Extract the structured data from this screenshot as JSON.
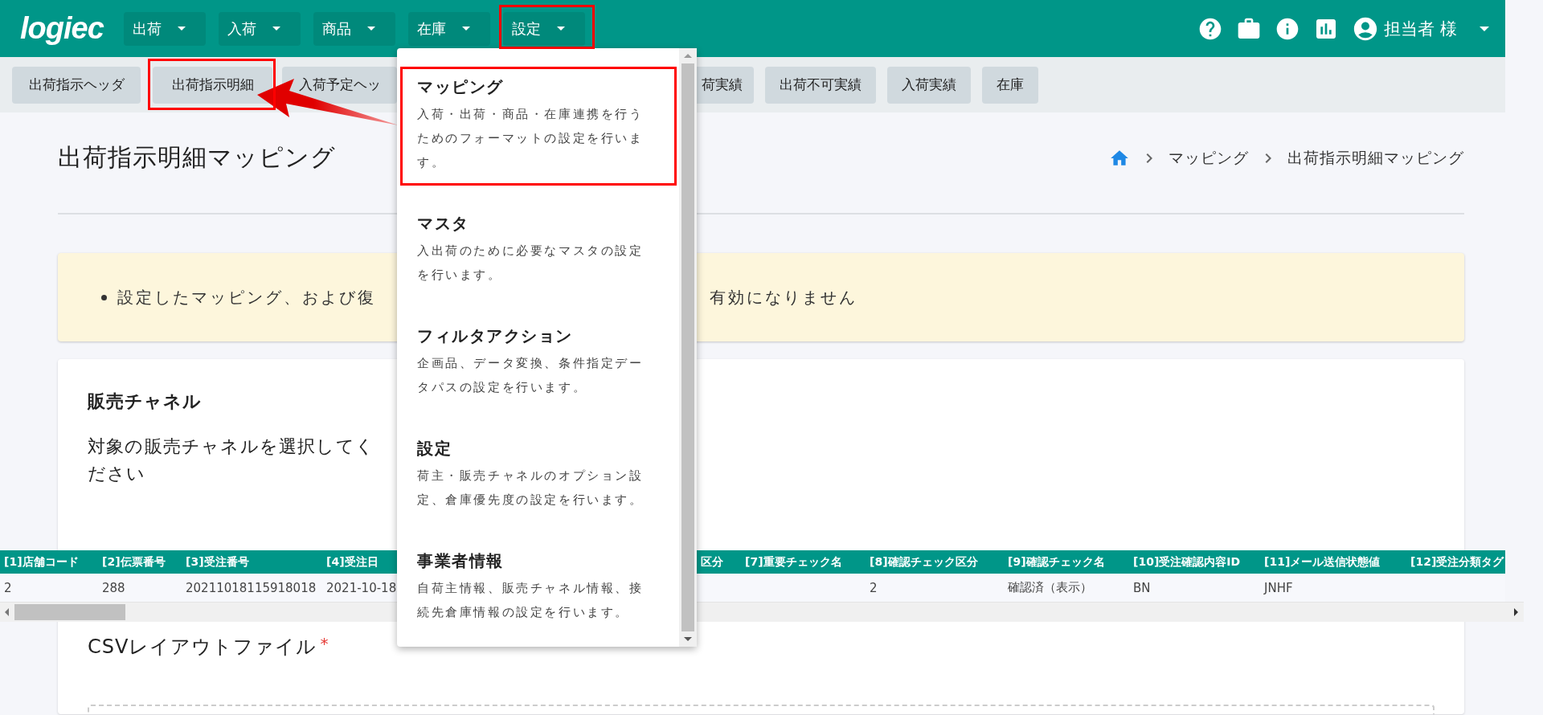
{
  "header": {
    "logo": "logiec",
    "menus": [
      {
        "label": "出荷"
      },
      {
        "label": "入荷"
      },
      {
        "label": "商品"
      },
      {
        "label": "在庫"
      },
      {
        "label": "設定"
      }
    ],
    "user": "担当者 様"
  },
  "subnav": {
    "tabs_left": [
      "出荷指示ヘッダ",
      "出荷指示明細",
      "入荷予定ヘッ"
    ],
    "tabs_right": [
      "荷実績",
      "出荷不可実績",
      "入荷実績",
      "在庫"
    ]
  },
  "page": {
    "title": "出荷指示明細マッピング",
    "breadcrumb": [
      "マッピング",
      "出荷指示明細マッピング"
    ]
  },
  "notice": {
    "text_left": "設定したマッピング、および復",
    "text_right": "有効になりません"
  },
  "card": {
    "section_title": "販売チャネル",
    "description": "対象の販売チャネルを選択してください",
    "file_label": "CSVレイアウトファイル",
    "required_mark": "*"
  },
  "table": {
    "columns": [
      "[1]店舗コード",
      "[2]伝票番号",
      "[3]受注番号",
      "[4]受注日",
      "区分",
      "[7]重要チェック名",
      "[8]確認チェック区分",
      "[9]確認チェック名",
      "[10]受注確認内容ID",
      "[11]メール送信状態値",
      "[12]受注分類タグ"
    ],
    "rows": [
      [
        "2",
        "288",
        "20211018115918018",
        "2021-10-18",
        null,
        null,
        "2",
        "確認済（表示）",
        "BN",
        "JNHF",
        null
      ]
    ]
  },
  "dropdown": {
    "items": [
      {
        "title": "マッピング",
        "description": "入荷・出荷・商品・在庫連携を行うためのフォーマットの設定を行います。"
      },
      {
        "title": "マスタ",
        "description": "入出荷のために必要なマスタの設定を行います。"
      },
      {
        "title": "フィルタアクション",
        "description": "企画品、データ変換、条件指定データパスの設定を行います。"
      },
      {
        "title": "設定",
        "description": "荷主・販売チャネルのオプション設定、倉庫優先度の設定を行います。"
      },
      {
        "title": "事業者情報",
        "description": "自荷主情報、販売チャネル情報、接続先倉庫情報の設定を行います。"
      }
    ]
  }
}
